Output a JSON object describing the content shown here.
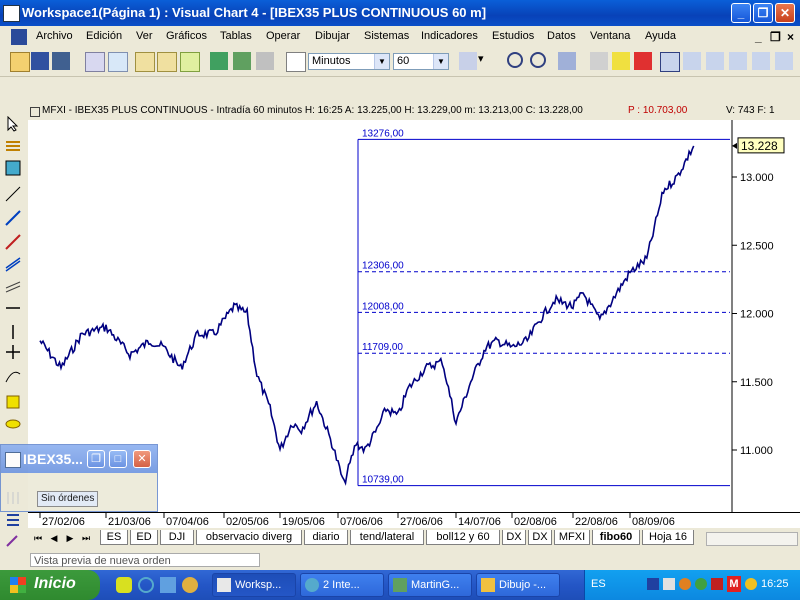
{
  "window": {
    "title": "Workspace1(Página 1) : Visual Chart 4 - [IBEX35 PLUS CONTINUOUS 60 m]"
  },
  "menu": [
    "Archivo",
    "Edición",
    "Ver",
    "Gráficos",
    "Tablas",
    "Operar",
    "Dibujar",
    "Sistemas",
    "Indicadores",
    "Estudios",
    "Datos",
    "Ventana",
    "Ayuda"
  ],
  "toolbar": {
    "period_unit": "Minutos",
    "period_value": "60"
  },
  "chart_header": {
    "text": "MFXI - IBEX35 PLUS CONTINUOUS - Intradía 60 minutos  H: 16:25  A: 13.225,00  H: 13.229,00  m: 13.213,00  C: 13.228,00",
    "p_text": "P : 10.703,00",
    "v_text": "V: 743  F: 1"
  },
  "floating_window": {
    "title": "IBEX35...",
    "orders_label": "Sin órdenes"
  },
  "tabs": [
    "ES",
    "ED",
    "DJI",
    "observacio diverg",
    "diario",
    "tend/lateral",
    "boll12 y 60",
    "DX",
    "DX",
    "MFXI",
    "fibo60",
    "Hoja 16"
  ],
  "selected_tab": "fibo60",
  "status_text": "Vista previa de nueva orden",
  "taskbar": {
    "start_label": "Inicio",
    "tasks": [
      "Worksp...",
      "2 Inte...",
      "MartinG...",
      "Dibujo -..."
    ],
    "tray_lang": "ES",
    "clock": "16:25"
  },
  "colors": {
    "price_line": "#000080",
    "fib_line": "#0000cc",
    "last_price_box": "#ffffc0"
  },
  "chart_data": {
    "type": "line",
    "instrument": "IBEX35 PLUS CONTINUOUS",
    "interval": "60 minutos",
    "x_ticks": [
      "27/02/06",
      "21/03/06",
      "07/04/06",
      "02/05/06",
      "19/05/06",
      "07/06/06",
      "27/06/06",
      "14/07/06",
      "02/08/06",
      "22/08/06",
      "08/09/06"
    ],
    "y_ticks": [
      11000,
      11500,
      12000,
      12500,
      13000
    ],
    "y_tick_labels": [
      "11.000",
      "11.500",
      "12.000",
      "12.500",
      "13.000"
    ],
    "ylim": [
      10500,
      13500
    ],
    "last_price": "13.228",
    "fib_levels": [
      {
        "label": "13276,00",
        "value": 13276
      },
      {
        "label": "12306,00",
        "value": 12306
      },
      {
        "label": "12008,00",
        "value": 12008
      },
      {
        "label": "11709,00",
        "value": 11709
      },
      {
        "label": "10739,00",
        "value": 10739
      }
    ],
    "series": [
      {
        "x": [
          "27/02/06",
          "06/03/06",
          "13/03/06",
          "21/03/06",
          "28/03/06",
          "03/04/06",
          "07/04/06",
          "14/04/06",
          "21/04/06",
          "28/04/06",
          "02/05/06",
          "05/05/06",
          "09/05/06",
          "12/05/06",
          "16/05/06",
          "19/05/06",
          "23/05/06",
          "26/05/06",
          "31/05/06",
          "05/06/06",
          "07/06/06",
          "09/06/06",
          "13/06/06",
          "16/06/06",
          "20/06/06",
          "23/06/06",
          "27/06/06",
          "30/06/06",
          "05/07/06",
          "10/07/06",
          "14/07/06",
          "19/07/06",
          "24/07/06",
          "28/07/06",
          "02/08/06",
          "07/08/06",
          "11/08/06",
          "16/08/06",
          "22/08/06",
          "25/08/06",
          "30/08/06",
          "04/09/06",
          "08/09/06",
          "13/09/06",
          "18/09/06",
          "22/09/06",
          "27/09/06"
        ],
        "values": [
          11800,
          11600,
          11850,
          11900,
          11700,
          11800,
          11750,
          11600,
          11850,
          11850,
          11950,
          12050,
          12000,
          11550,
          11300,
          11000,
          11200,
          11150,
          11350,
          11050,
          10900,
          10750,
          11050,
          11000,
          11150,
          11300,
          11250,
          11450,
          11600,
          11650,
          11200,
          11500,
          11750,
          11800,
          11750,
          11800,
          11950,
          12100,
          12050,
          12150,
          11950,
          12150,
          12300,
          12400,
          12900,
          13000,
          13228
        ]
      }
    ]
  }
}
